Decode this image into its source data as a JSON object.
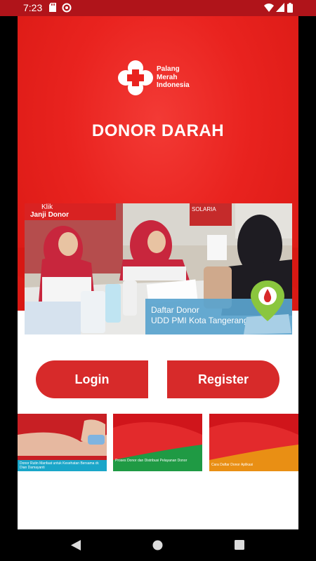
{
  "status_bar": {
    "time": "7:23",
    "icons": [
      "sd-card-icon",
      "sync-icon",
      "wifi-icon",
      "signal-icon",
      "battery-icon"
    ]
  },
  "header": {
    "logo_lines": [
      "Palang",
      "Merah",
      "Indonesia"
    ],
    "title": "DONOR DARAH"
  },
  "banner": {
    "klik": "Klik",
    "janji_donor": "Janji Donor",
    "daftar_line1": "Daftar Donor",
    "daftar_line2": "UDD PMI Kota Tangerang",
    "solaria": "SOLARIA"
  },
  "buttons": {
    "login": "Login",
    "register": "Register"
  },
  "thumbnails": [
    {
      "caption": "Donor Rutin Manfaat untuk Kesehatan Bersama dr. Dian Damayanti",
      "stripe": "#1aa6c9"
    },
    {
      "caption": "Proses Donor dan Distribusi Pelayanan Donor",
      "stripe": "#1f9a44"
    },
    {
      "caption": "Cara Daftar Donor Aplikasi",
      "stripe": "#e98f14"
    }
  ],
  "colors": {
    "primary_red": "#e9231f",
    "button_red": "#d72a2a",
    "status_bar": "#b0141a"
  },
  "nav_bar": {
    "icons": [
      "back-icon",
      "home-icon",
      "recents-icon"
    ]
  }
}
